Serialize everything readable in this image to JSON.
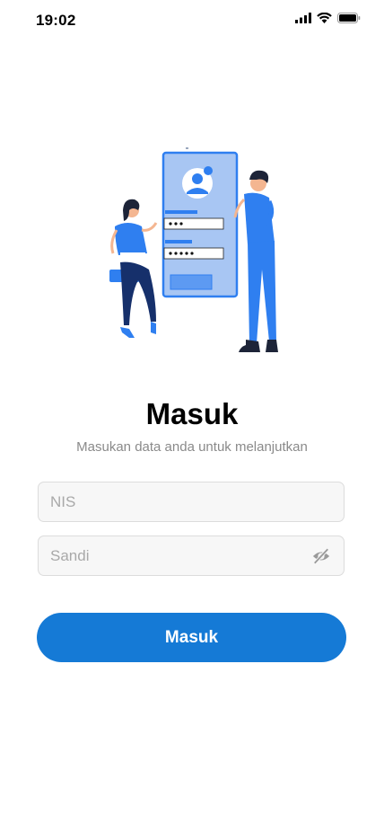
{
  "status_bar": {
    "time": "19:02"
  },
  "login": {
    "title": "Masuk",
    "subtitle": "Masukan data anda untuk melanjutkan",
    "nis_placeholder": "NIS",
    "password_placeholder": "Sandi",
    "submit_label": "Masuk",
    "password_toggle_icon": "eye-off-icon"
  },
  "colors": {
    "accent": "#157ad6",
    "illustration_blue": "#2f7ff0",
    "illustration_light": "#a8c6f3"
  }
}
